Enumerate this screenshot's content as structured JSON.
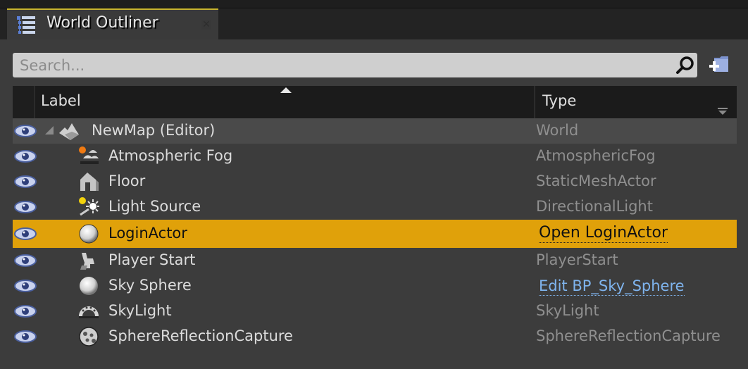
{
  "tab": {
    "title": "World Outliner",
    "icon": "list-icon",
    "close_icon": "close-icon",
    "accent_color": "#c9b531"
  },
  "search": {
    "placeholder": "Search...",
    "value": "",
    "search_icon": "magnifier-icon",
    "add_folder_icon": "add-folder-icon"
  },
  "columns": {
    "label": "Label",
    "type": "Type",
    "sort_indicator": "ascending"
  },
  "rows": [
    {
      "label": "NewMap (Editor)",
      "type": "World",
      "icon": "world-icon",
      "visible": true,
      "expanded": true,
      "level": 0
    },
    {
      "label": "Atmospheric Fog",
      "type": "AtmosphericFog",
      "icon": "atmospheric-fog-icon",
      "visible": true,
      "level": 1
    },
    {
      "label": "Floor",
      "type": "StaticMeshActor",
      "icon": "static-mesh-icon",
      "visible": true,
      "level": 1
    },
    {
      "label": "Light Source",
      "type": "DirectionalLight",
      "icon": "directional-light-icon",
      "visible": true,
      "level": 1
    },
    {
      "label": "LoginActor",
      "type": "Open LoginActor",
      "icon": "actor-sphere-icon",
      "visible": true,
      "level": 1,
      "selected": true,
      "type_is_link": true
    },
    {
      "label": "Player Start",
      "type": "PlayerStart",
      "icon": "player-start-icon",
      "visible": true,
      "level": 1
    },
    {
      "label": "Sky Sphere",
      "type": "Edit BP_Sky_Sphere",
      "icon": "actor-sphere-icon",
      "visible": true,
      "level": 1,
      "type_is_link": true
    },
    {
      "label": "SkyLight",
      "type": "SkyLight",
      "icon": "sky-light-icon",
      "visible": true,
      "level": 1
    },
    {
      "label": "SphereReflectionCapture",
      "type": "SphereReflectionCapture",
      "icon": "sphere-reflection-capture-icon",
      "visible": true,
      "level": 1
    }
  ],
  "colors": {
    "selection": "#e0a10a",
    "link": "#7fb4ee",
    "type_text": "#8f8f8f"
  }
}
